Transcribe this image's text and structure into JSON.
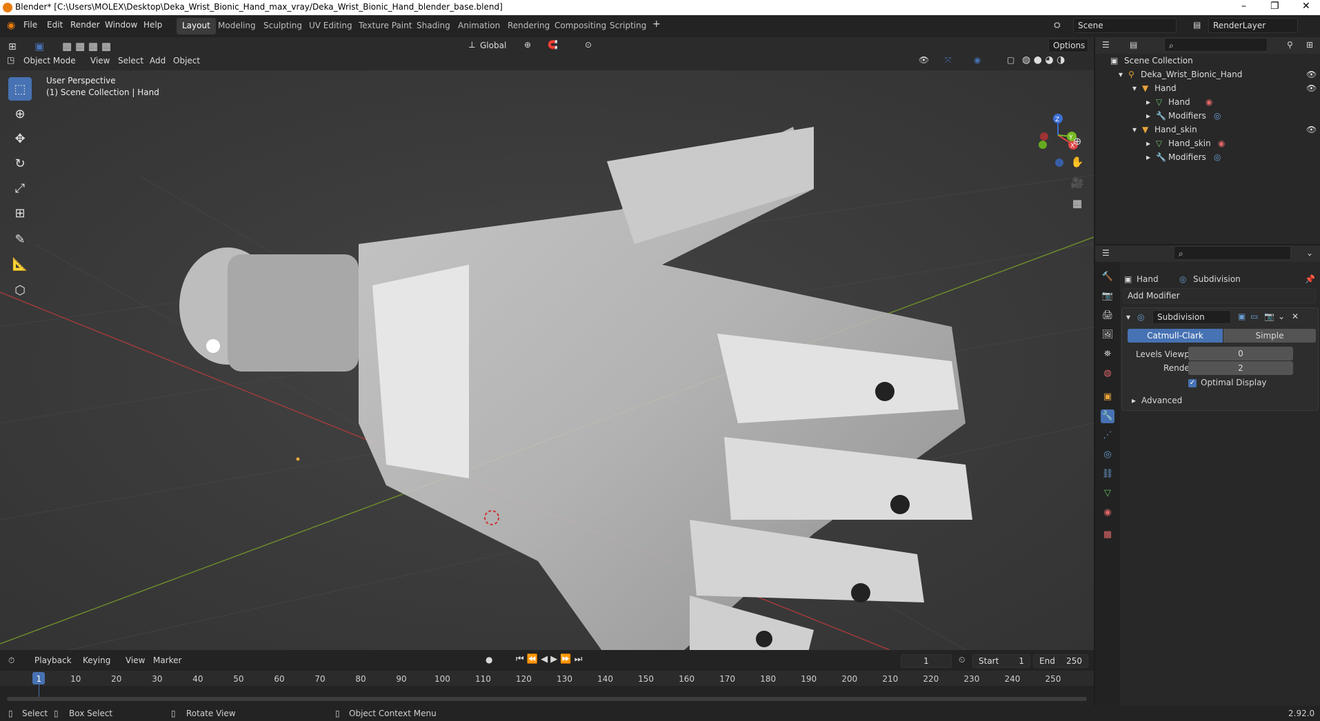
{
  "window": {
    "title": "Blender* [C:\\Users\\MOLEX\\Desktop\\Deka_Wrist_Bionic_Hand_max_vray/Deka_Wrist_Bionic_Hand_blender_base.blend]",
    "minimize": "–",
    "restore": "❐",
    "close": "✕"
  },
  "menu": {
    "file": "File",
    "edit": "Edit",
    "render": "Render",
    "window": "Window",
    "help": "Help"
  },
  "workspaces": [
    "Layout",
    "Modeling",
    "Sculpting",
    "UV Editing",
    "Texture Paint",
    "Shading",
    "Animation",
    "Rendering",
    "Compositing",
    "Scripting"
  ],
  "scene": {
    "label": "Scene",
    "layer": "RenderLayer"
  },
  "viewport": {
    "mode": "Object Mode",
    "view": "View",
    "select": "Select",
    "add": "Add",
    "object": "Object",
    "orientation": "Global",
    "options": "Options",
    "perspective": "User Perspective",
    "collection_info": "(1) Scene Collection | Hand",
    "axes": {
      "x": "X",
      "y": "Y",
      "z": "Z"
    }
  },
  "outliner": {
    "rows": [
      {
        "label": "Scene Collection"
      },
      {
        "label": "Deka_Wrist_Bionic_Hand"
      },
      {
        "label": "Hand"
      },
      {
        "label": "Hand"
      },
      {
        "label": "Modifiers"
      },
      {
        "label": "Hand_skin"
      },
      {
        "label": "Hand_skin"
      },
      {
        "label": "Modifiers"
      }
    ]
  },
  "properties": {
    "object_name": "Hand",
    "modifier_type": "Subdivision",
    "add_modifier": "Add Modifier",
    "modifier_name": "Subdivision",
    "algo_catmull": "Catmull-Clark",
    "algo_simple": "Simple",
    "levels_viewport_label": "Levels Viewport",
    "levels_viewport_value": "0",
    "render_label": "Render",
    "render_value": "2",
    "optimal_display": "Optimal Display",
    "advanced": "Advanced"
  },
  "timeline": {
    "playback": "Playback",
    "keying": "Keying",
    "view": "View",
    "marker": "Marker",
    "current_frame": "1",
    "start_label": "Start",
    "start_value": "1",
    "end_label": "End",
    "end_value": "250",
    "ticks": [
      "1",
      "10",
      "20",
      "30",
      "40",
      "50",
      "60",
      "70",
      "80",
      "90",
      "100",
      "110",
      "120",
      "130",
      "140",
      "150",
      "160",
      "170",
      "180",
      "190",
      "200",
      "210",
      "220",
      "230",
      "240",
      "250"
    ]
  },
  "status": {
    "select": "Select",
    "box_select": "Box Select",
    "rotate_view": "Rotate View",
    "context_menu": "Object Context Menu",
    "version": "2.92.0"
  },
  "colors": {
    "accent": "#4772b3",
    "active_orange": "#e87d0d"
  }
}
